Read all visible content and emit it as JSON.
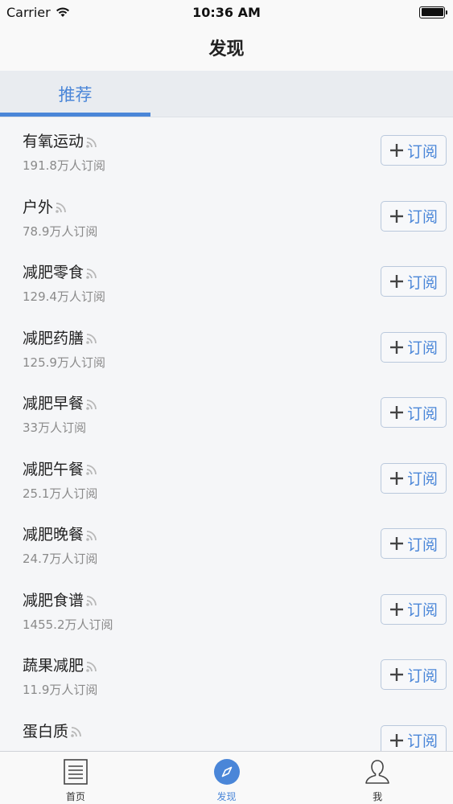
{
  "status": {
    "carrier": "Carrier",
    "time": "10:36 AM"
  },
  "nav": {
    "title": "发现"
  },
  "tabs": [
    {
      "label": "推荐",
      "active": true
    }
  ],
  "subscribe_label": "订阅",
  "items": [
    {
      "title": "有氧运动",
      "subscribers": "191.8万人订阅"
    },
    {
      "title": "户外",
      "subscribers": "78.9万人订阅"
    },
    {
      "title": "减肥零食",
      "subscribers": "129.4万人订阅"
    },
    {
      "title": "减肥药膳",
      "subscribers": "125.9万人订阅"
    },
    {
      "title": "减肥早餐",
      "subscribers": "33万人订阅"
    },
    {
      "title": "减肥午餐",
      "subscribers": "25.1万人订阅"
    },
    {
      "title": "减肥晚餐",
      "subscribers": "24.7万人订阅"
    },
    {
      "title": "减肥食谱",
      "subscribers": "1455.2万人订阅"
    },
    {
      "title": "蔬果减肥",
      "subscribers": "11.9万人订阅"
    },
    {
      "title": "蛋白质",
      "subscribers": ""
    }
  ],
  "bottom_tabs": [
    {
      "label": "首页",
      "icon": "document-icon",
      "active": false
    },
    {
      "label": "发现",
      "icon": "compass-icon",
      "active": true
    },
    {
      "label": "我",
      "icon": "user-icon",
      "active": false
    }
  ],
  "colors": {
    "accent": "#4a86d8",
    "background": "#f5f6f8"
  }
}
